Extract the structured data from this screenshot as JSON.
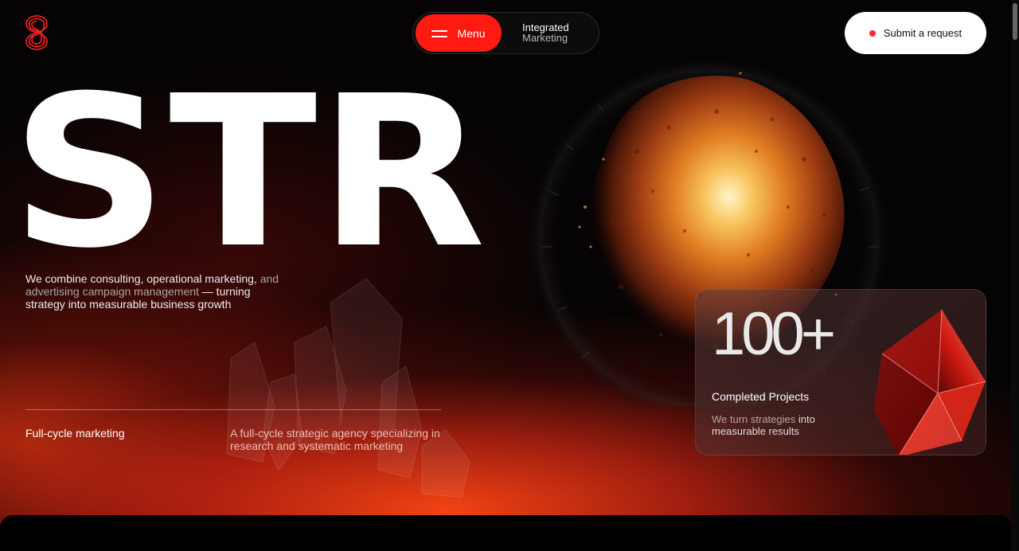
{
  "header": {
    "logo_name": "s-logo",
    "menu_label": "Menu",
    "tagline_line1": "Integrated",
    "tagline_line2": "Marketing",
    "request_label": "Submit a request"
  },
  "hero": {
    "word": "STR",
    "description_part1": "We combine consulting, operational marketing,",
    "description_part2": "and advertising campaign management",
    "description_part3": "— turning strategy into measurable business growth"
  },
  "service": {
    "title": "Full-cycle marketing",
    "description": "A full-cycle strategic agency specializing in research and systematic marketing"
  },
  "stats": {
    "number": "100+",
    "label": "Completed Projects",
    "desc_part1": "We turn strategies",
    "desc_part2": "into measurable results"
  },
  "colors": {
    "accent": "#ff1a12",
    "background": "#050303",
    "glow": "#ff4614"
  }
}
